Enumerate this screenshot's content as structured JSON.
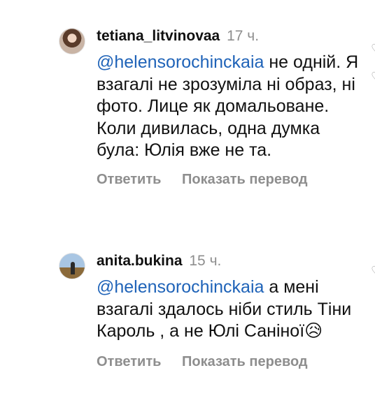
{
  "comments": [
    {
      "username": "tetiana_litvinovaa",
      "time": "17 ч.",
      "mention": "@helensorochinckaia",
      "text": " не одній. Я взагалі не зрозуміла ні образ, ні фото. Лице як домальоване. Коли дивилась, одна думка була: Юлія вже не та.",
      "reply_label": "Ответить",
      "translate_label": "Показать перевод"
    },
    {
      "username": "anita.bukina",
      "time": "15 ч.",
      "mention": "@helensorochinckaia",
      "text": " а мені взагалі здалось ніби стиль Тіни Кароль , а не Юлі Саніної😥",
      "reply_label": "Ответить",
      "translate_label": "Показать перевод"
    }
  ]
}
